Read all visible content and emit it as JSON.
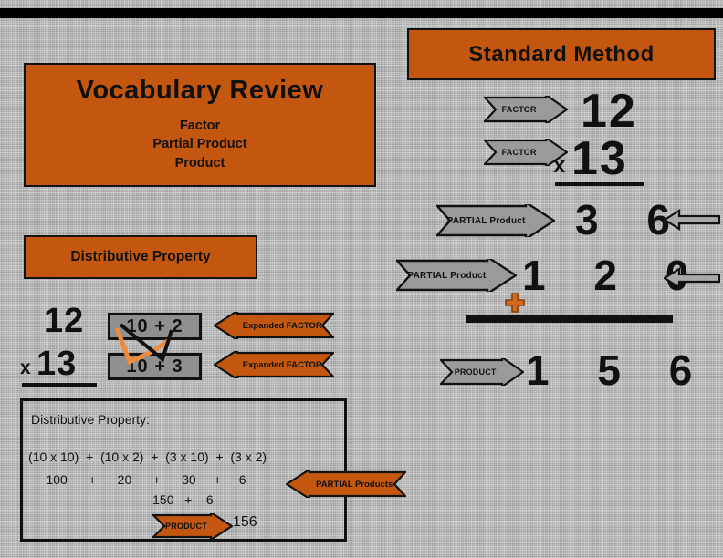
{
  "slide": {
    "top_rule": true,
    "vocabulary": {
      "title": "Vocabulary Review",
      "terms": "Factor\nPartial Product\nProduct"
    },
    "standard_method": {
      "title": "Standard Method",
      "factor_tag_1": "FACTOR",
      "factor_tag_2": "FACTOR",
      "factor_1": "12",
      "multiply_symbol": "x",
      "factor_2": "13",
      "partial_tag_1": "PARTIAL Product",
      "partial_tag_2": "PARTIAL Product",
      "partial_product_1": "3 6",
      "partial_product_2": "1 2 0",
      "plus_symbol": "+",
      "product_tag": "PRODUCT",
      "product": "1 5 6"
    },
    "distributive": {
      "title": "Distributive Property",
      "factor_1": "12",
      "multiply_symbol": "x",
      "factor_2": "13",
      "expanded_1": "10 + 2",
      "expanded_2": "10 + 3",
      "expanded_tag_1": "Expanded FACTOR",
      "expanded_tag_2": "Expanded FACTOR"
    },
    "distributive_detail": {
      "heading": "Distributive Property:",
      "row_expressions": "(10 x 10)  +  (10 x 2)  +  (3 x 10)  +  (3 x 2)",
      "row_products": "     100      +      20      +      30     +     6",
      "row_sums": "                                   150   +    6",
      "partial_products_tag": "PARTIAL Products",
      "product_tag": "PRODUCT",
      "product": "156"
    },
    "colors": {
      "orange": "#c4570f",
      "gray_arrow": "#9a9a9a",
      "gray_box": "#8f8f8f",
      "background": "#b9b9b9",
      "ink": "#111111"
    }
  }
}
